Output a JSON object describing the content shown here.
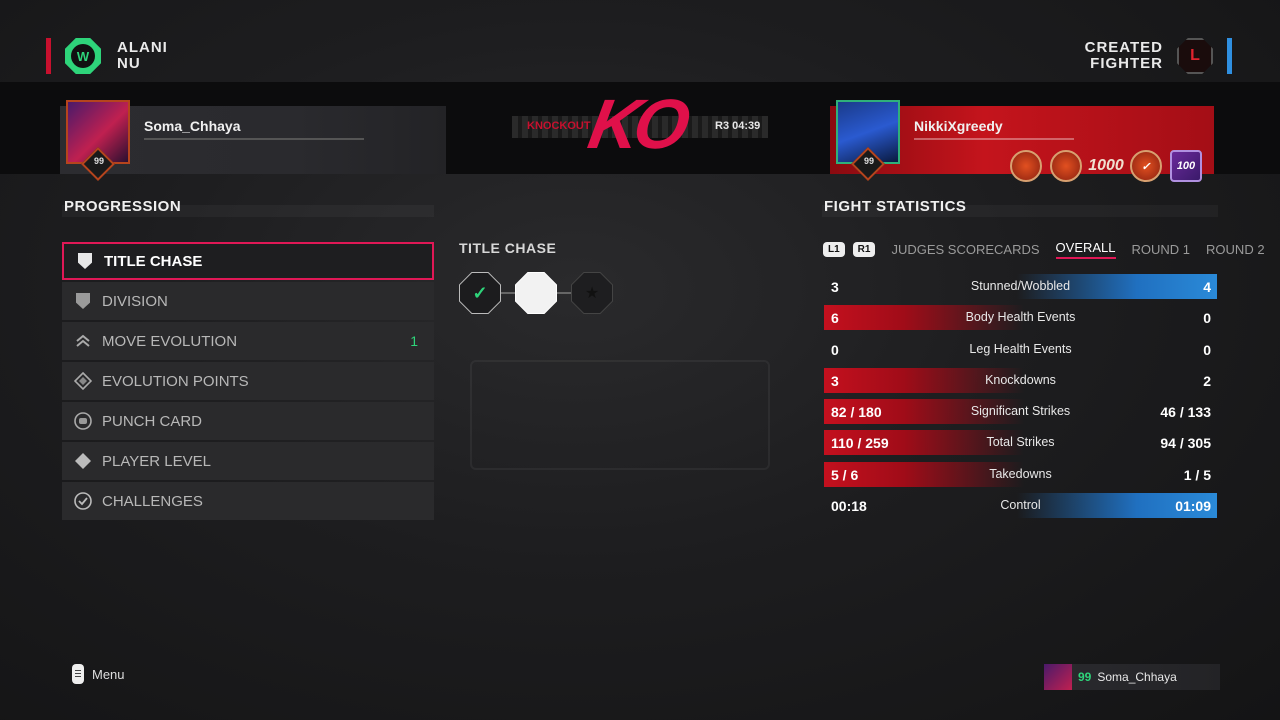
{
  "left_corner": {
    "name": "ALANI\nNU",
    "badge": "W"
  },
  "right_corner": {
    "name": "CREATED\nFIGHTER",
    "badge": "L"
  },
  "left_fighter": {
    "gamertag": "Soma_Chhaya",
    "ovr": "99"
  },
  "right_fighter": {
    "gamertag": "NikkiXgreedy",
    "ovr": "99",
    "medals": [
      "",
      "",
      "1000",
      "✓",
      "100"
    ]
  },
  "fight_result": {
    "method": "KNOCKOUT",
    "time": "R3 04:39",
    "mark": "KO"
  },
  "progression": {
    "title": "PROGRESSION",
    "items": [
      {
        "label": "TITLE CHASE",
        "icon": "shield-icon",
        "count": ""
      },
      {
        "label": "DIVISION",
        "icon": "shield-icon",
        "count": ""
      },
      {
        "label": "MOVE EVOLUTION",
        "icon": "chevron-up-icon",
        "count": "1"
      },
      {
        "label": "EVOLUTION POINTS",
        "icon": "diamond-icon",
        "count": ""
      },
      {
        "label": "PUNCH CARD",
        "icon": "punch-card-icon",
        "count": ""
      },
      {
        "label": "PLAYER LEVEL",
        "icon": "diamond-icon",
        "count": ""
      },
      {
        "label": "CHALLENGES",
        "icon": "check-circle-icon",
        "count": ""
      }
    ]
  },
  "title_chase": {
    "title": "TITLE CHASE",
    "steps": [
      "✓",
      "",
      "★"
    ]
  },
  "fight_statistics": {
    "title": "FIGHT STATISTICS",
    "buttons": [
      "L1",
      "R1"
    ],
    "tabs": [
      "JUDGES SCORECARDS",
      "OVERALL",
      "ROUND 1",
      "ROUND 2"
    ],
    "active_tab": "OVERALL",
    "rows": [
      {
        "label": "Stunned/Wobbled",
        "left": "3",
        "right": "4",
        "leader": "right"
      },
      {
        "label": "Body Health Events",
        "left": "6",
        "right": "0",
        "leader": "left"
      },
      {
        "label": "Leg Health Events",
        "left": "0",
        "right": "0",
        "leader": "none"
      },
      {
        "label": "Knockdowns",
        "left": "3",
        "right": "2",
        "leader": "left"
      },
      {
        "label": "Significant Strikes",
        "left": "82 / 180",
        "right": "46 / 133",
        "leader": "left"
      },
      {
        "label": "Total Strikes",
        "left": "110 / 259",
        "right": "94 / 305",
        "leader": "left"
      },
      {
        "label": "Takedowns",
        "left": "5 / 6",
        "right": "1 / 5",
        "leader": "left"
      },
      {
        "label": "Control",
        "left": "00:18",
        "right": "01:09",
        "leader": "right"
      }
    ]
  },
  "footer": {
    "menu_label": "Menu",
    "player_ovr": "99",
    "player_name": "Soma_Chhaya"
  },
  "colors": {
    "red": "#c8102e",
    "blue": "#2f8fe0",
    "accent_pink": "#e01856",
    "green": "#2ed47a"
  }
}
